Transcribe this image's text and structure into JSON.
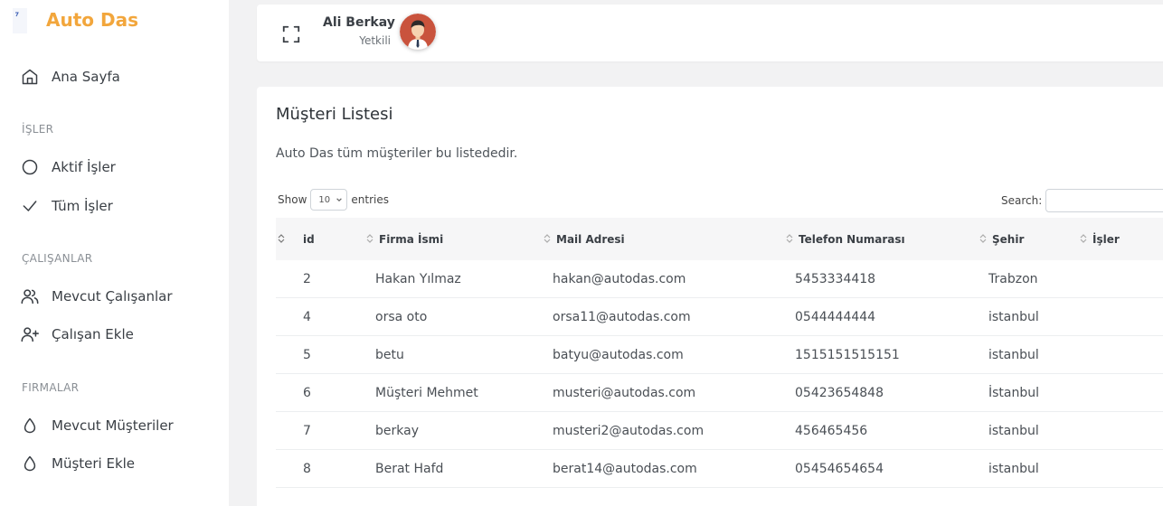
{
  "brand": {
    "title": "Auto Das"
  },
  "sidebar": {
    "home": {
      "label": "Ana Sayfa"
    },
    "sections": [
      {
        "title": "İŞLER",
        "items": [
          {
            "label": "Aktif İşler"
          },
          {
            "label": "Tüm İşler"
          }
        ]
      },
      {
        "title": "ÇALIŞANLAR",
        "items": [
          {
            "label": "Mevcut Çalışanlar"
          },
          {
            "label": "Çalışan Ekle"
          }
        ]
      },
      {
        "title": "FIRMALAR",
        "items": [
          {
            "label": "Mevcut Müşteriler"
          },
          {
            "label": "Müşteri Ekle"
          }
        ]
      }
    ]
  },
  "topbar": {
    "user_name": "Ali Berkay",
    "user_role": "Yetkili"
  },
  "card": {
    "title": "Müşteri Listesi",
    "description": "Auto Das tüm müşteriler bu listededir."
  },
  "table_controls": {
    "show_label": "Show",
    "page_length": "10",
    "entries_label": "entries",
    "search_label": "Search:"
  },
  "table": {
    "columns": [
      "id",
      "Firma İsmi",
      "Mail Adresi",
      "Telefon Numarası",
      "Şehir",
      "İşler"
    ],
    "rows": [
      [
        "2",
        "Hakan Yılmaz",
        "hakan@autodas.com",
        "5453334418",
        "Trabzon",
        ""
      ],
      [
        "4",
        "orsa oto",
        "orsa11@autodas.com",
        "0544444444",
        "istanbul",
        ""
      ],
      [
        "5",
        "betu",
        "batyu@autodas.com",
        "1515151515151",
        "istanbul",
        ""
      ],
      [
        "6",
        "Müşteri Mehmet",
        "musteri@autodas.com",
        "05423654848",
        "İstanbul",
        ""
      ],
      [
        "7",
        "berkay",
        "musteri2@autodas.com",
        "456465456",
        "istanbul",
        ""
      ],
      [
        "8",
        "Berat Hafd",
        "berat14@autodas.com",
        "05454654654",
        "istanbul",
        ""
      ]
    ]
  },
  "colors": {
    "brand": "#f2a63c",
    "background": "#f2f2f3"
  }
}
